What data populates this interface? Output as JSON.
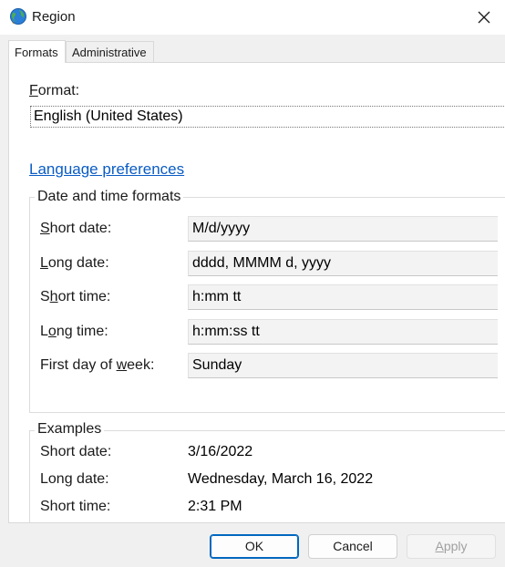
{
  "window": {
    "title": "Region"
  },
  "tabs": [
    {
      "label": "Formats",
      "active": true
    },
    {
      "label": "Administrative",
      "active": false
    }
  ],
  "format": {
    "label_prefix": "F",
    "label_rest": "ormat:",
    "value": "English (United States)"
  },
  "language_link": "Language preferences",
  "date_time_formats": {
    "title": "Date and time formats",
    "rows": [
      {
        "pre": "",
        "key": "S",
        "post": "hort date:",
        "value": "M/d/yyyy"
      },
      {
        "pre": "",
        "key": "L",
        "post": "ong date:",
        "value": "dddd, MMMM d, yyyy"
      },
      {
        "pre": "S",
        "key": "h",
        "post": "ort time:",
        "value": "h:mm tt"
      },
      {
        "pre": "L",
        "key": "o",
        "post": "ng time:",
        "value": "h:mm:ss tt"
      },
      {
        "pre": "First day of ",
        "key": "w",
        "post": "eek:",
        "value": "Sunday"
      }
    ]
  },
  "examples": {
    "title": "Examples",
    "rows": [
      {
        "label": "Short date:",
        "value": "3/16/2022"
      },
      {
        "label": "Long date:",
        "value": "Wednesday, March 16, 2022"
      },
      {
        "label": "Short time:",
        "value": "2:31 PM"
      }
    ]
  },
  "buttons": {
    "ok": "OK",
    "cancel": "Cancel",
    "apply_key": "A",
    "apply_rest": "pply"
  },
  "icons": {
    "app": "globe-icon",
    "close": "close-icon"
  },
  "colors": {
    "link": "#0a5cc4",
    "primary_border": "#0067c0",
    "disabled_text": "#a0a0a0"
  }
}
